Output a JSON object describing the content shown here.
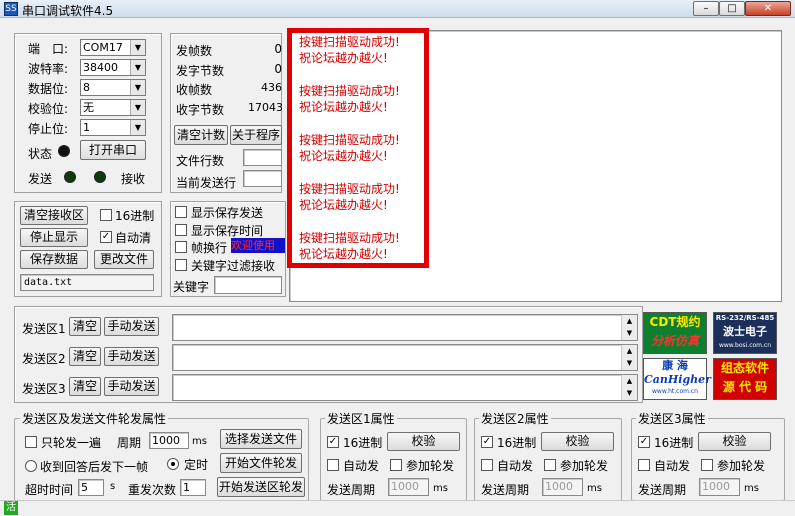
{
  "window": {
    "title": "串口调试软件4.5",
    "icon_label": "SS",
    "minimize": "–",
    "maximize": "□",
    "close": "✕"
  },
  "port": {
    "port_label": "端　口:",
    "port_value": "COM17",
    "baud_label": "波特率:",
    "baud_value": "38400",
    "data_label": "数据位:",
    "data_value": "8",
    "parity_label": "校验位:",
    "parity_value": "无",
    "stop_label": "停止位:",
    "stop_value": "1",
    "status_label": "状态",
    "open_btn": "打开串口",
    "send_label": "发送",
    "recv_label": "接收"
  },
  "counters": {
    "sent_frames_label": "发帧数",
    "sent_frames_value": "0",
    "sent_bytes_label": "发字节数",
    "sent_bytes_value": "0",
    "recv_frames_label": "收帧数",
    "recv_frames_value": "436",
    "recv_bytes_label": "收字节数",
    "recv_bytes_value": "17043",
    "clear_btn": "清空计数",
    "about_btn": "关于程序",
    "file_lines_label": "文件行数",
    "current_line_label": "当前发送行"
  },
  "recv_controls": {
    "clear_recv_btn": "清空接收区",
    "hex_label": "16进制",
    "stop_display_btn": "停止显示",
    "auto_clear_label": "自动清",
    "save_data_btn": "保存数据",
    "change_file_btn": "更改文件",
    "file_name": "data.txt"
  },
  "display_opts": {
    "show_save_send": "显示保存发送",
    "show_save_time": "显示保存时间",
    "frame_newline": "帧换行",
    "frame_newline_tag": "欢迎使用",
    "keyword_filter": "关键字过滤接收",
    "keyword_label": "关键字"
  },
  "receive": {
    "lines": [
      "按键扫描驱动成功!",
      "祝论坛越办越火!",
      "",
      "按键扫描驱动成功!",
      "祝论坛越办越火!",
      "",
      "按键扫描驱动成功!",
      "祝论坛越办越火!",
      "",
      "按键扫描驱动成功!",
      "祝论坛越办越火!",
      "",
      "按键扫描驱动成功!",
      "祝论坛越办越火!"
    ]
  },
  "send_areas": [
    {
      "label": "发送区1",
      "clear": "清空",
      "manual": "手动发送"
    },
    {
      "label": "发送区2",
      "clear": "清空",
      "manual": "手动发送"
    },
    {
      "label": "发送区3",
      "clear": "清空",
      "manual": "手动发送"
    }
  ],
  "ads": {
    "cdt_line1": "CDT规约",
    "cdt_line2": "分析仿真",
    "rs_top": "RS-232/RS-485",
    "rs_mid": "波士电子",
    "rs_url": "www.bosi.com.cn",
    "kh_line1": "康 海",
    "kh_line2": "CanHigher",
    "kh_url": "www.ht.com.cn",
    "zt_line1": "组态软件",
    "zt_line2": "源 代 码"
  },
  "poll": {
    "group_title": "发送区及发送文件轮发属性",
    "only_once": "只轮发一遍",
    "period_label": "周期",
    "period_value": "1000",
    "period_unit": "ms",
    "select_file_btn": "选择发送文件",
    "wait_reply": "收到回答后发下一帧",
    "timed": "定时",
    "start_file_btn": "开始文件轮发",
    "timeout_label": "超时时间",
    "timeout_value": "5",
    "timeout_unit": "s",
    "retry_label": "重发次数",
    "retry_value": "1",
    "start_area_btn": "开始发送区轮发"
  },
  "area_props": [
    {
      "title": "发送区1属性",
      "hex": "16进制",
      "check_btn": "校验",
      "auto_send": "自动发",
      "join_poll": "参加轮发",
      "period_label": "发送周期",
      "period_value": "1000",
      "unit": "ms"
    },
    {
      "title": "发送区2属性",
      "hex": "16进制",
      "check_btn": "校验",
      "auto_send": "自动发",
      "join_poll": "参加轮发",
      "period_label": "发送周期",
      "period_value": "1000",
      "unit": "ms"
    },
    {
      "title": "发送区3属性",
      "hex": "16进制",
      "check_btn": "校验",
      "auto_send": "自动发",
      "join_poll": "参加轮发",
      "period_label": "发送周期",
      "period_value": "1000",
      "unit": "ms"
    }
  ],
  "statusbar": {
    "icon": "活"
  },
  "colors": {
    "highlight_border": "#e00000",
    "recv_text": "#d40000",
    "led_dark": "#101010",
    "led_green": "#0b3d0b"
  }
}
